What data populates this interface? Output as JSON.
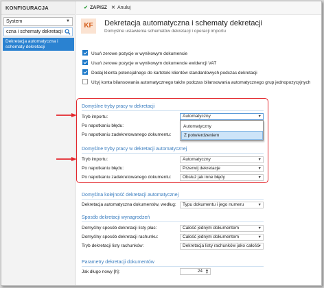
{
  "sidebar": {
    "title": "KONFIGURACJA",
    "scope_select": "System",
    "search_value": "czna i schematy dekretacji",
    "selected_item": "Dekretacja automatyczna i schematy dekretacji"
  },
  "toolbar": {
    "save_label": "ZAPISZ",
    "cancel_label": "Anuluj"
  },
  "header": {
    "badge": "KF",
    "title": "Dekretacja automatyczna i schematy dekretacji",
    "subtitle": "Domyślne ustawienia schematów dekretacji i operacji importu"
  },
  "options": [
    {
      "label": "Usuń zerowe pozycje w wynikowym dokumencie",
      "checked": true
    },
    {
      "label": "Usuń zerowe pozycje w wynikowym dokumencie ewidencji VAT",
      "checked": true
    },
    {
      "label": "Dodaj klienta potencjalnego do kartoteki klientów standardowych podczas dekretacji",
      "checked": true
    },
    {
      "label": "Użyj konta bilansowania automatycznego także podczas bilansowania automatycznego grup jednopozycyjnych",
      "checked": false
    }
  ],
  "section_default": {
    "title": "Domyślne tryby pracy w dekretacji",
    "import_mode_label": "Tryb importu:",
    "import_mode_value": "Automatyczny",
    "error_label": "Po napotkaniu błędu:",
    "posted_label": "Po napotkaniu zadekretowanego dokumentu:",
    "dropdown_options": [
      "Automatyczny",
      "Z potwierdzeniem"
    ]
  },
  "section_auto": {
    "title": "Domyślne tryby pracy w dekretacji automatycznej",
    "import_mode_label": "Tryb importu:",
    "import_mode_value": "Automatyczny",
    "error_label": "Po napotkaniu błędu:",
    "error_value": "Przerwij dekretacje",
    "posted_label": "Po napotkaniu zadekretowanego dokumentu:",
    "posted_value": "Obsłuż jak inne błędy"
  },
  "section_order": {
    "title": "Domyślna kolejność dekretacji automatycznej",
    "label": "Dekretacja automatyczna dokumentów, według:",
    "value": "Typu dokumentu i jego numeru"
  },
  "section_salary": {
    "title": "Sposób dekretacji wynagrodzeń",
    "salary_lists_label": "Domyślny sposób dekretacji listy płac:",
    "salary_lists_value": "Całość jednym dokumentem",
    "bills_label": "Domyślny sposób dekretacji rachunku:",
    "bills_value": "Całość jednym dokumentem",
    "bills_list_label": "Tryb dekretacji listy rachunków:",
    "bills_list_value": "Dekretacja listy rachunków jako całość"
  },
  "section_params": {
    "title": "Parametry dekretacji dokumentów",
    "duration_label": "Jak długo nowy [h]:",
    "duration_value": "24"
  },
  "colors": {
    "accent": "#2a82d1",
    "highlight": "#e3262c",
    "section_title": "#3a7dbf",
    "badge_bg": "#fbe3d2",
    "badge_fg": "#d35b17"
  }
}
